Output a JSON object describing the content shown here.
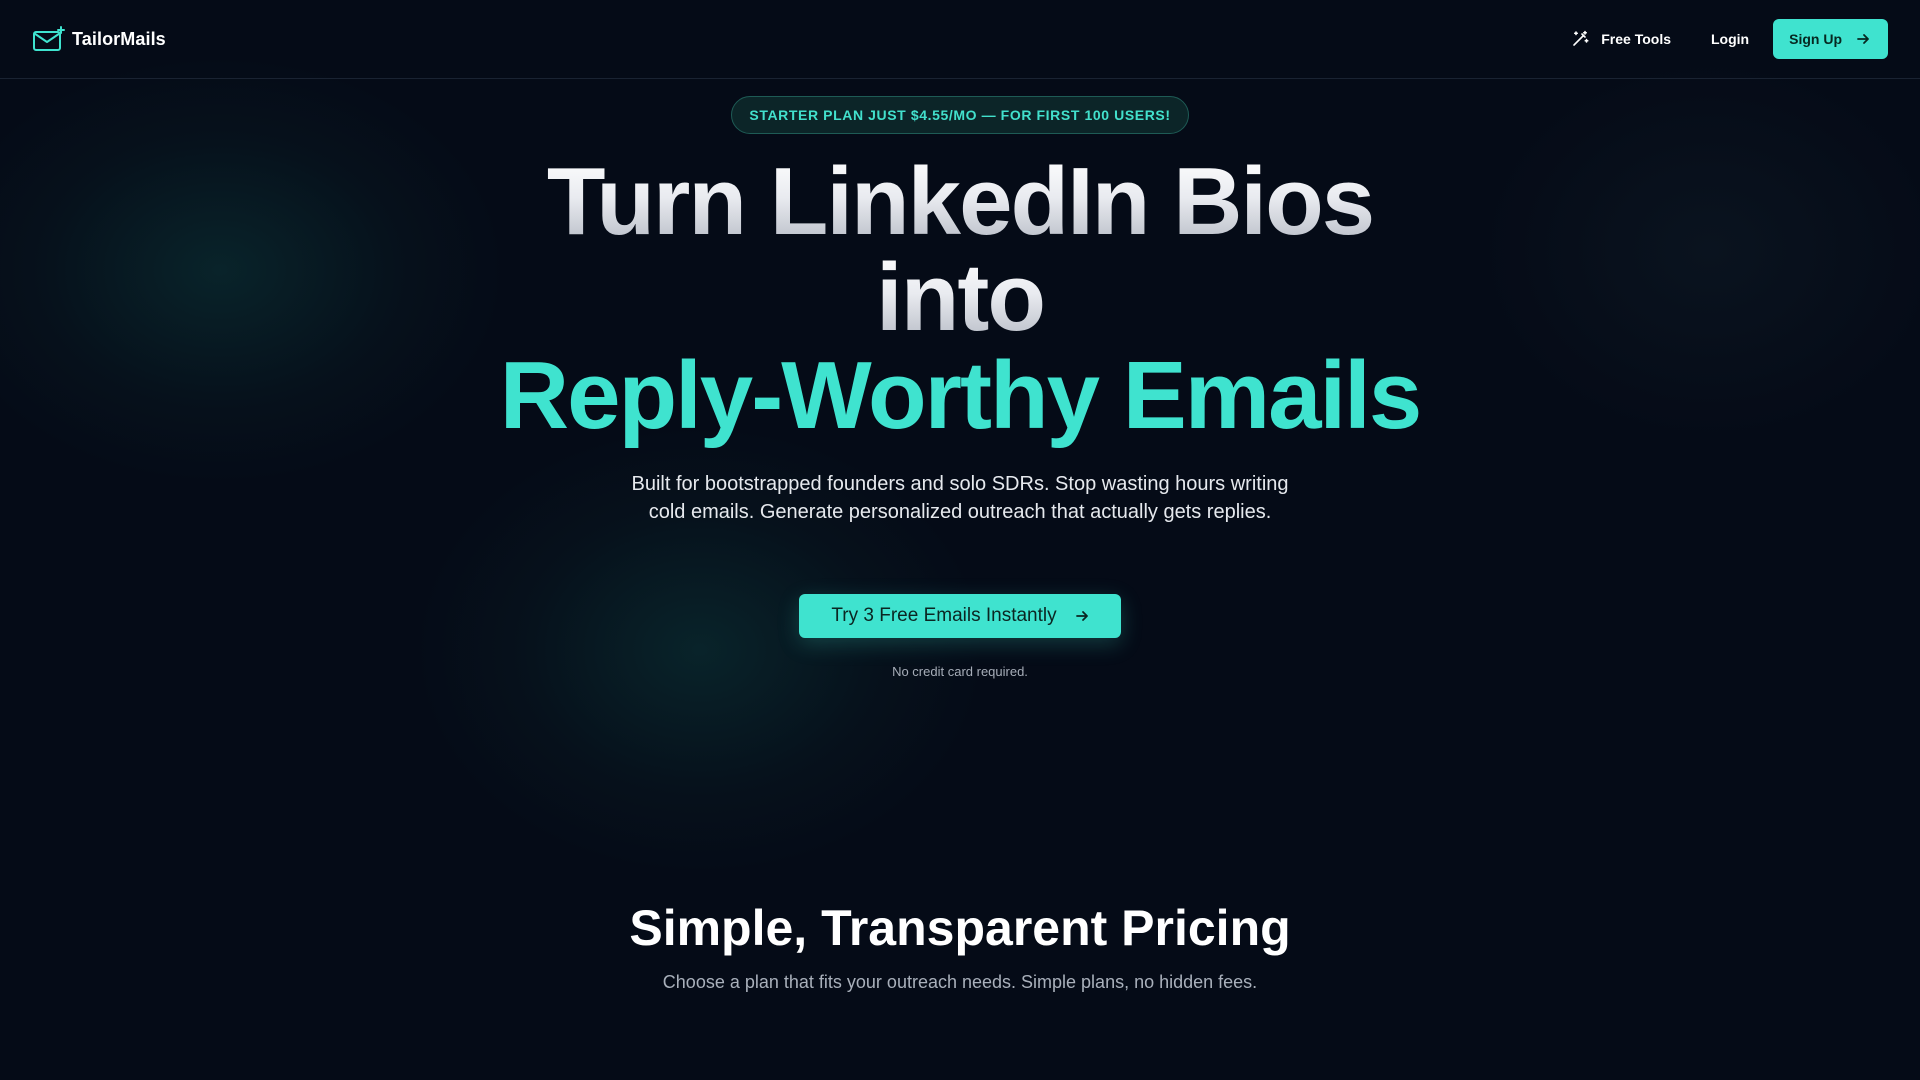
{
  "header": {
    "brand_name": "TailorMails",
    "brand_icon": "envelope-sparkle-icon",
    "nav": {
      "free_tools_label": "Free Tools",
      "free_tools_icon": "magic-wand-icon",
      "login_label": "Login",
      "signup_label": "Sign Up",
      "signup_icon": "arrow-right-icon"
    }
  },
  "hero": {
    "promo_badge": "STARTER PLAN JUST $4.55/MO — FOR FIRST 100 USERS!",
    "headline_line1": "Turn LinkedIn Bios",
    "headline_line2": "into",
    "headline_accent": "Reply-Worthy Emails",
    "subtext": "Built for bootstrapped founders and solo SDRs. Stop wasting hours writing cold emails. Generate personalized outreach that actually gets replies.",
    "cta_label": "Try 3 Free Emails Instantly",
    "cta_icon": "arrow-right-icon",
    "note": "No credit card required."
  },
  "pricing": {
    "title": "Simple, Transparent Pricing",
    "subtitle": "Choose a plan that fits your outreach needs. Simple plans, no hidden fees."
  },
  "colors": {
    "background": "#050b17",
    "accent": "#3fe3cf",
    "promo_text": "#42e0cc",
    "muted_text": "#a9b0bb"
  }
}
